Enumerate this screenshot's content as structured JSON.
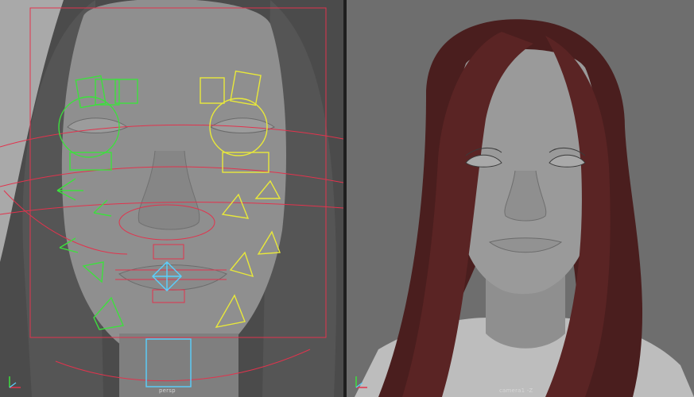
{
  "viewports": {
    "left": {
      "camera_label": "persp"
    },
    "right": {
      "camera_label": "camera1 -Z"
    }
  },
  "icons": {
    "axis_indicator": "axis-gizmo-icon"
  },
  "colors": {
    "left_bg": "#a9a9a9",
    "right_bg": "#6e6e6e",
    "skin": "#8f8f8f",
    "hair_left": "#4b4b4b",
    "hair_right": "#4a1e1e",
    "rig_green": "#3de03d",
    "rig_yellow": "#e8e83a",
    "rig_red": "#e2334d",
    "rig_cyan": "#5ad0ff"
  }
}
